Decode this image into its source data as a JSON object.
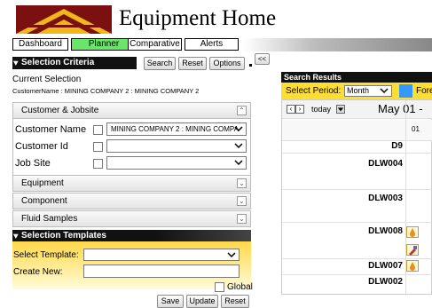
{
  "app": {
    "title": "Equipment Home"
  },
  "nav": {
    "tabs": [
      "Dashboard",
      "Planner",
      "Comparative",
      "Alerts"
    ],
    "active": "Planner"
  },
  "criteria": {
    "header": "Selection Criteria",
    "buttons": {
      "search": "Search",
      "reset": "Reset",
      "options": "Options",
      "collapse": "<<"
    },
    "current_selection_label": "Current Selection",
    "current_selection_value": "CustomerName : MINING COMPANY 2 : MINING COMPANY 2",
    "sections": {
      "customer_jobsite": "Customer & Jobsite",
      "equipment": "Equipment",
      "component": "Component",
      "fluid_samples": "Fluid Samples"
    },
    "fields": {
      "customer_name": {
        "label": "Customer Name",
        "value": "MINING COMPANY 2 : MINING COMPA"
      },
      "customer_id": {
        "label": "Customer Id",
        "value": ""
      },
      "job_site": {
        "label": "Job Site",
        "value": ""
      }
    }
  },
  "templates": {
    "header": "Selection Templates",
    "select_label": "Select Template:",
    "select_value": "",
    "create_label": "Create New:",
    "create_value": "",
    "global_label": "Global",
    "buttons": {
      "save": "Save",
      "update": "Update",
      "reset": "Reset"
    }
  },
  "results": {
    "header": "Search Results",
    "period_label": "Select Period:",
    "period_value": "Month",
    "forecast_partial": "Fore",
    "today_label": "today",
    "date_title": "May 01 -",
    "day_col": "01",
    "rows": [
      "D9",
      "DLW004",
      "DLW003",
      "DLW008",
      "DLW007",
      "DLW002"
    ]
  },
  "colors": {
    "nav_active": "#69e669",
    "template_bg": "#ffd84a",
    "period_bar": "#ffdd33",
    "legend_swatch": "#3399ff"
  }
}
